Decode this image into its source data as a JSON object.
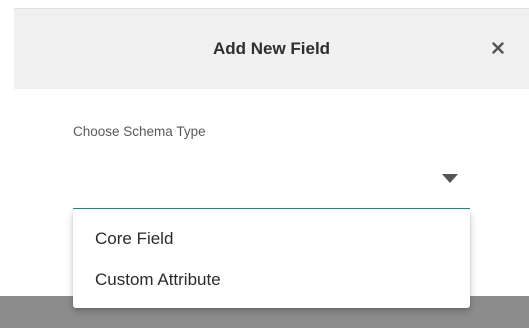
{
  "modal": {
    "title": "Add New Field",
    "close_icon": "close-icon"
  },
  "form": {
    "schema_type": {
      "label": "Choose Schema Type",
      "selected_value": "",
      "arrow_icon": "caret-down-icon",
      "accent_color": "#1d8f86",
      "options": [
        {
          "label": "Core Field"
        },
        {
          "label": "Custom Attribute"
        }
      ]
    }
  }
}
